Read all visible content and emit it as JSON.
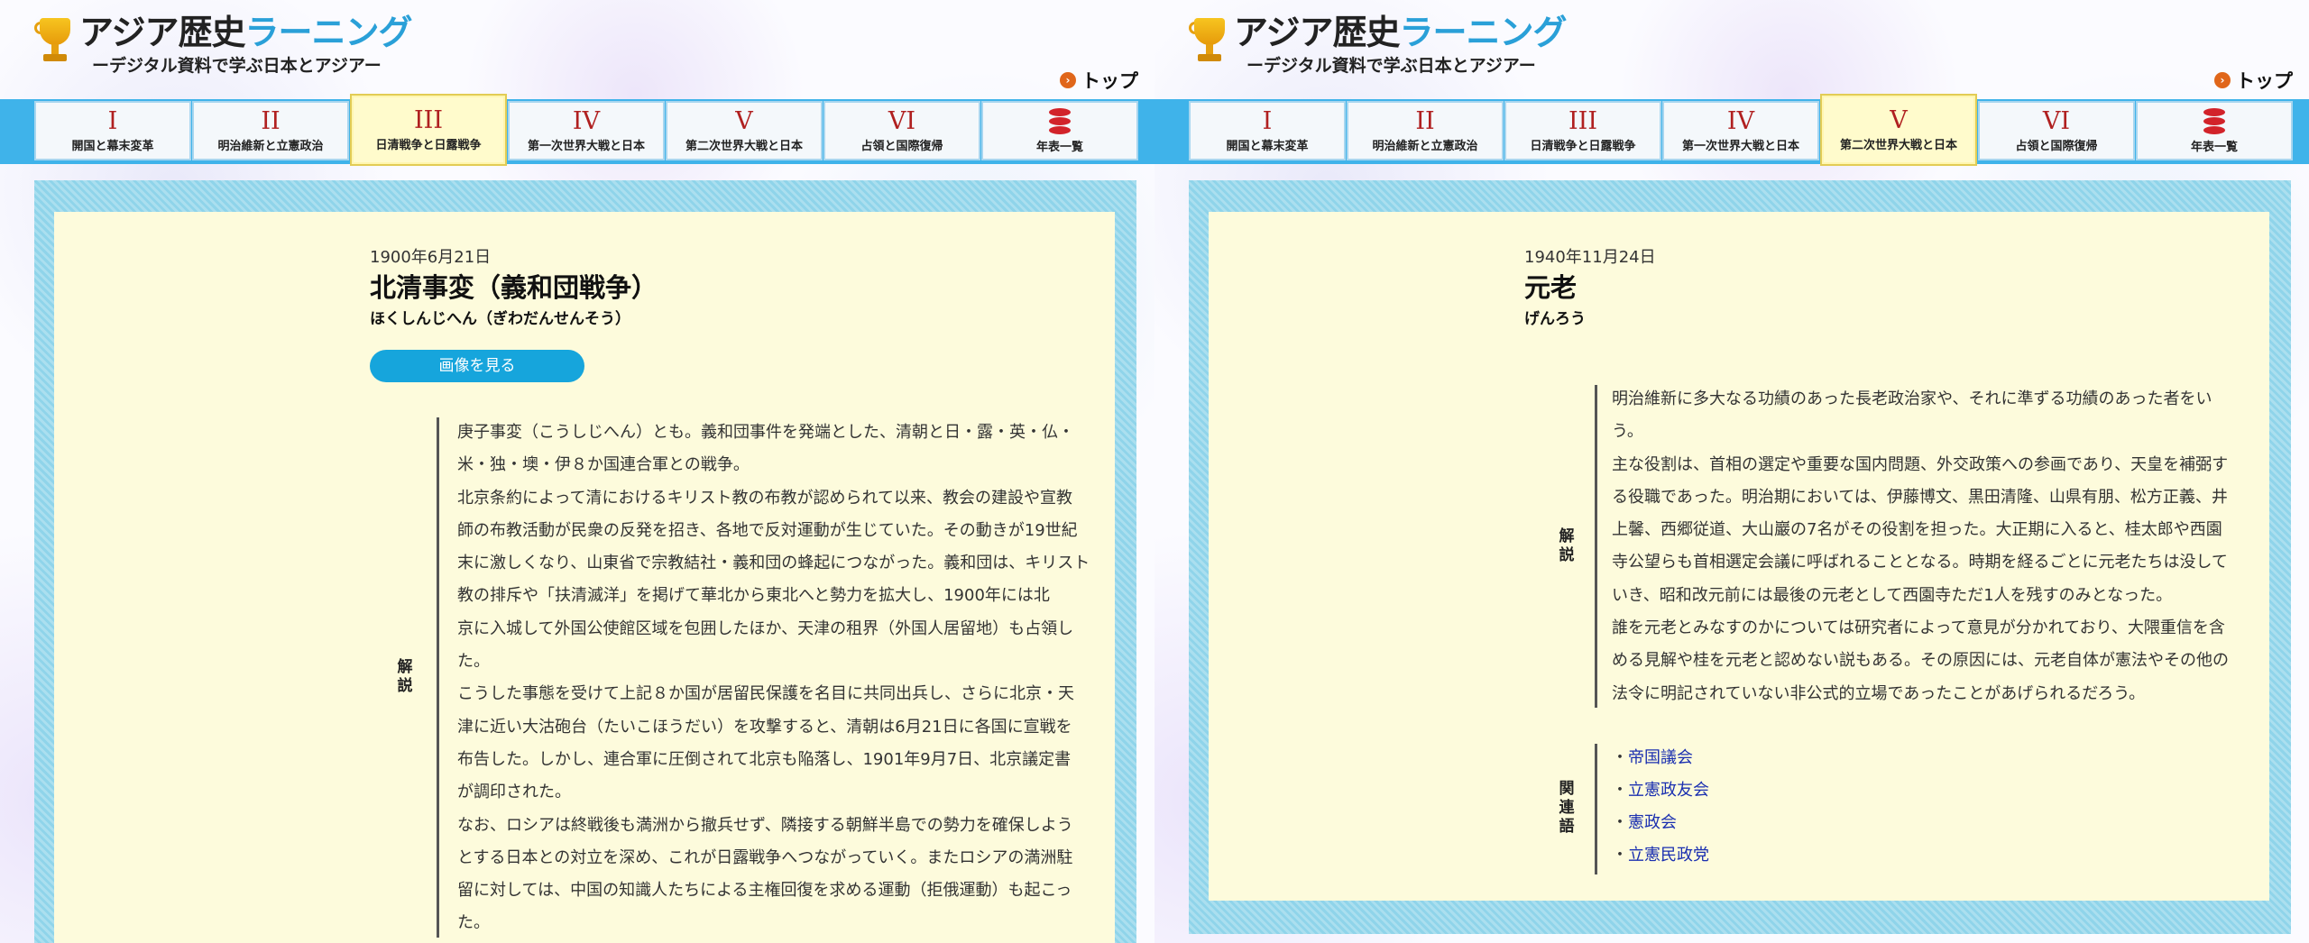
{
  "site": {
    "title_a": "アジア歴史",
    "title_b": "ラーニング",
    "subtitle": "ーデジタル資料で学ぶ日本とアジアー",
    "top_label": "トップ"
  },
  "nav": [
    {
      "num": "I",
      "label": "開国と幕末変革"
    },
    {
      "num": "II",
      "label": "明治維新と立憲政治"
    },
    {
      "num": "III",
      "label": "日清戦争と日露戦争"
    },
    {
      "num": "IV",
      "label": "第一次世界大戦と日本"
    },
    {
      "num": "V",
      "label": "第二次世界大戦と日本"
    },
    {
      "num": "VI",
      "label": "占領と国際復帰"
    },
    {
      "num": "",
      "label": "年表一覧"
    }
  ],
  "left": {
    "active_nav": 2,
    "date": "1900年6月21日",
    "title": "北清事変（義和団戦争）",
    "reading": "ほくしんじへん（ぎわだんせんそう）",
    "image_button": "画像を見る",
    "section_label": "解説",
    "lines": [
      "庚子事変（こうしじへん）とも。義和団事件を発端とした、清朝と日・露・英・仏・",
      "米・独・墺・伊８か国連合軍との戦争。",
      "北京条約によって清におけるキリスト教の布教が認められて以来、教会の建設や宣教",
      "師の布教活動が民衆の反発を招き、各地で反対運動が生じていた。その動きが19世紀",
      "末に激しくなり、山東省で宗教結社・義和団の蜂起につながった。義和団は、キリスト",
      "教の排斥や「扶清滅洋」を掲げて華北から東北へと勢力を拡大し、1900年には北",
      "京に入城して外国公使館区域を包囲したほか、天津の租界（外国人居留地）も占領し",
      "た。",
      "こうした事態を受けて上記８か国が居留民保護を名目に共同出兵し、さらに北京・天",
      "津に近い大沽砲台（たいこほうだい）を攻撃すると、清朝は6月21日に各国に宣戦を",
      "布告した。しかし、連合軍に圧倒されて北京も陥落し、1901年9月7日、北京議定書",
      "が調印された。",
      "なお、ロシアは終戦後も満洲から撤兵せず、隣接する朝鮮半島での勢力を確保しよう",
      "とする日本との対立を深め、これが日露戦争へつながっていく。またロシアの満洲駐",
      "留に対しては、中国の知識人たちによる主権回復を求める運動（拒俄運動）も起こっ",
      "た。"
    ]
  },
  "right": {
    "active_nav": 4,
    "date": "1940年11月24日",
    "title": "元老",
    "reading": "げんろう",
    "section_label": "解説",
    "lines": [
      "明治維新に多大なる功績のあった長老政治家や、それに準ずる功績のあった者をい",
      "う。",
      "主な役割は、首相の選定や重要な国内問題、外交政策への参画であり、天皇を補弼す",
      "る役職であった。明治期においては、伊藤博文、黒田清隆、山県有朋、松方正義、井",
      "上馨、西郷従道、大山巖の7名がその役割を担った。大正期に入ると、桂太郎や西園",
      "寺公望らも首相選定会議に呼ばれることとなる。時期を経るごとに元老たちは没して",
      "いき、昭和改元前には最後の元老として西園寺ただ1人を残すのみとなった。",
      "誰を元老とみなすのかについては研究者によって意見が分かれており、大隈重信を含",
      "める見解や桂を元老と認めない説もある。その原因には、元老自体が憲法やその他の",
      "法令に明記されていない非公式的立場であったことがあげられるだろう。"
    ],
    "related_label": "関連語",
    "related": [
      "帝国議会",
      "立憲政友会",
      "憲政会",
      "立憲民政党"
    ]
  },
  "colors": {
    "nav_bar": "#3fb3ea",
    "accent_red": "#b02020",
    "button_blue": "#16a5dc",
    "paper": "#fdfbdc",
    "frame": "#8fd4ea",
    "link": "#1a2fb0"
  }
}
